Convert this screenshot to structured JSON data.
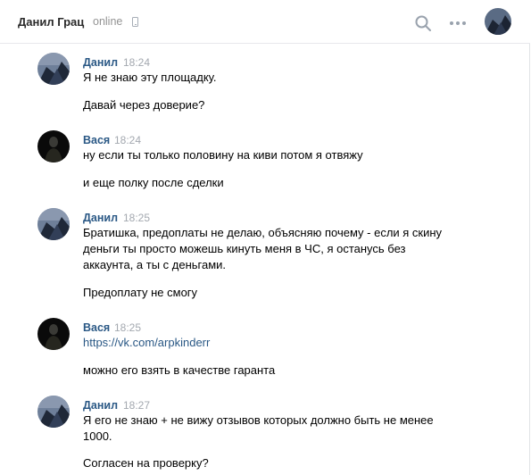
{
  "header": {
    "peer_name": "Данил Грац",
    "status": "online",
    "phone_icon": "mobile-phone-icon",
    "search_icon": "search-icon",
    "more_icon": "more-dots-icon"
  },
  "messages": [
    {
      "author": "Данил",
      "time": "18:24",
      "avatar": "danil",
      "lines": [
        "Я не знаю эту площадку.",
        "Давай через доверие?"
      ]
    },
    {
      "author": "Вася",
      "time": "18:24",
      "avatar": "vasya",
      "lines": [
        "ну если ты только половину на киви потом я отвяжу",
        "и еще полку после сделки"
      ]
    },
    {
      "author": "Данил",
      "time": "18:25",
      "avatar": "danil",
      "lines": [
        "Братишка, предоплаты не делаю, объясняю почему - если я скину деньги ты просто можешь кинуть меня в ЧС, я останусь без аккаунта, а ты с деньгами.",
        "Предоплату не смогу"
      ]
    },
    {
      "author": "Вася",
      "time": "18:25",
      "avatar": "vasya",
      "lines": [
        "https://vk.com/arpkinderr",
        "можно его взять в качестве гаранта"
      ]
    },
    {
      "author": "Данил",
      "time": "18:27",
      "avatar": "danil",
      "lines": [
        "Я его не знаю + не вижу отзывов которых должно быть не менее 1000.",
        "Согласен на проверку?"
      ]
    }
  ]
}
